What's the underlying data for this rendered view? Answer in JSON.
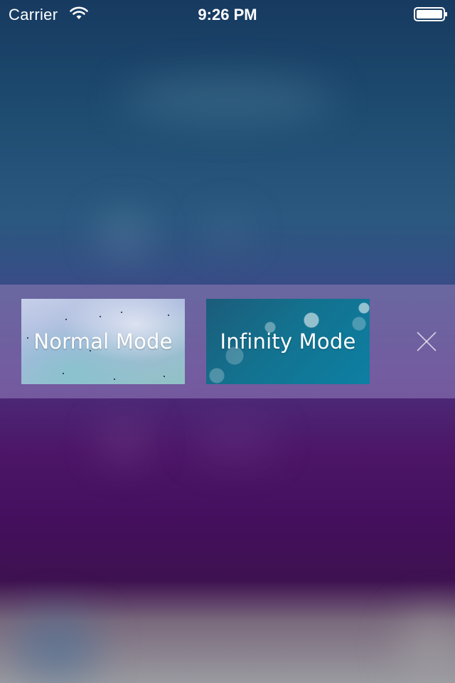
{
  "status_bar": {
    "carrier": "Carrier",
    "time": "9:26 PM",
    "wifi_icon": "wifi-icon",
    "battery_icon": "battery-icon"
  },
  "mode_menu": {
    "normal_mode_label": "Normal Mode",
    "infinity_mode_label": "Infinity Mode",
    "close_icon": "close-icon"
  },
  "colors": {
    "text": "#ffffff",
    "top_background": "#1f4d72",
    "bottom_background": "#4d1668"
  }
}
